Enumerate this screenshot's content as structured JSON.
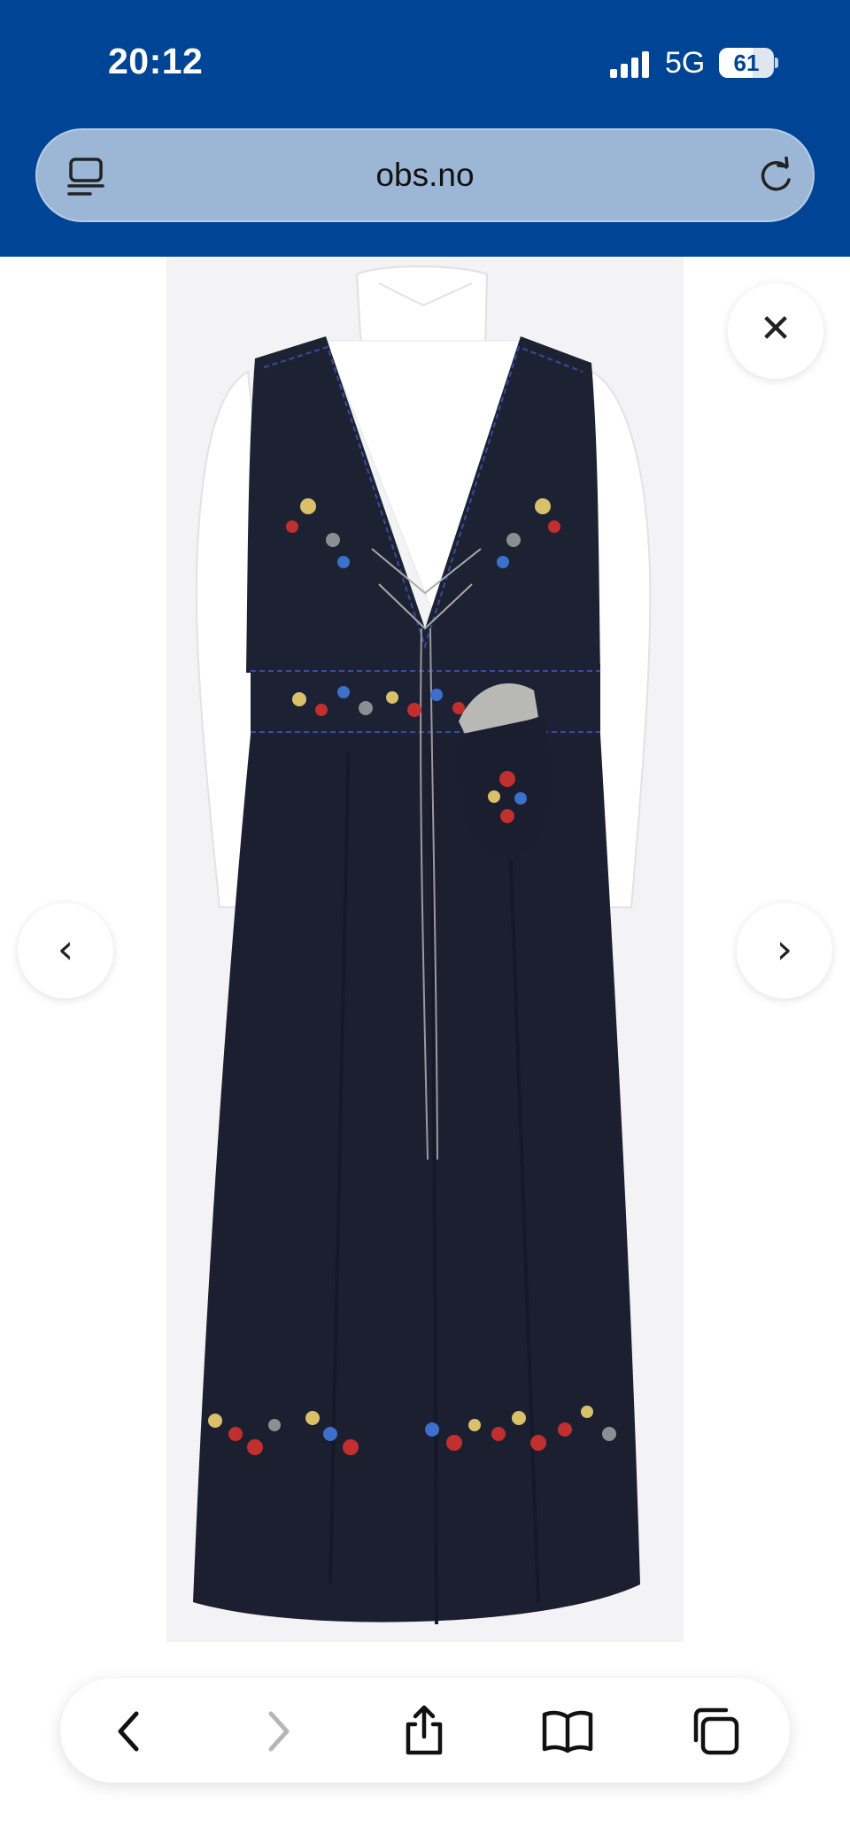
{
  "status_bar": {
    "time": "20:12",
    "network": "5G",
    "battery_level": "61",
    "battery_fraction": 0.61
  },
  "browser": {
    "url": "obs.no",
    "icons": {
      "reader": "reader-mode-icon",
      "reload": "reload-icon"
    }
  },
  "viewer": {
    "close_label": "✕",
    "prev_label": "‹",
    "next_label": "›",
    "image_subject": "bunad-product-photo"
  },
  "toolbar": {
    "items": [
      "back-icon",
      "forward-icon",
      "share-icon",
      "bookmarks-icon",
      "tabs-icon"
    ]
  },
  "colors": {
    "chrome_blue": "#004595",
    "url_pill": "#9cb6d6",
    "dress_navy": "#1d2233",
    "disabled": "#b5b5b5"
  }
}
